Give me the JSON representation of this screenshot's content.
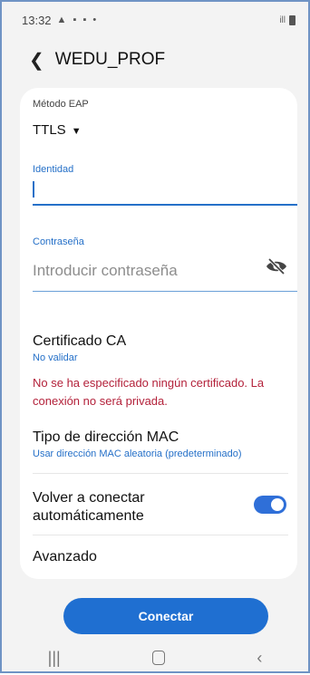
{
  "status": {
    "time": "13:32",
    "left_icons": "▲ ▪ ▪ •",
    "right_icons": "ill"
  },
  "header": {
    "back_icon": "chevron-left-icon",
    "title": "WEDU_PROF"
  },
  "form": {
    "eap_label": "Método EAP",
    "eap_value": "TTLS",
    "identity_label": "Identidad",
    "identity_value": "",
    "password_label": "Contraseña",
    "password_placeholder": "Introducir contraseña",
    "ca_title": "Certificado CA",
    "ca_value": "No validar",
    "ca_warning": "No se ha especificado ningún certificado. La conexión no será privada.",
    "mac_title": "Tipo de dirección MAC",
    "mac_value": "Usar dirección MAC aleatoria (predeterminado)",
    "autoconnect_label": "Volver a conectar automáticamente",
    "autoconnect_on": true,
    "advanced_label": "Avanzado"
  },
  "actions": {
    "connect_label": "Conectar"
  },
  "colors": {
    "accent": "#2570c8",
    "warning": "#b3213a",
    "button": "#1f6fd1"
  }
}
